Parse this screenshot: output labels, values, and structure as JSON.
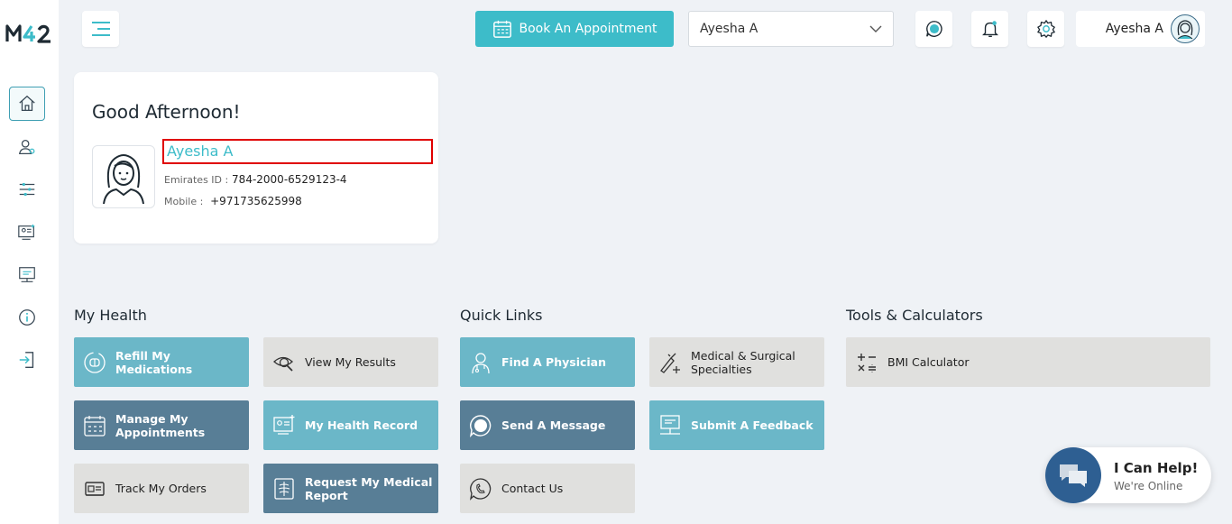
{
  "brand": {
    "logo_text": "M42",
    "accent": "#3dbcc9",
    "highlight_border": "#e00000"
  },
  "sidebar": {
    "items": [
      {
        "name": "home",
        "icon": "home-icon",
        "active": true
      },
      {
        "name": "profile",
        "icon": "user-doctor-icon"
      },
      {
        "name": "filters",
        "icon": "sliders-icon"
      },
      {
        "name": "health-record",
        "icon": "monitor-record-icon"
      },
      {
        "name": "feedback",
        "icon": "monitor-feedback-icon"
      },
      {
        "name": "info",
        "icon": "info-icon"
      },
      {
        "name": "logout",
        "icon": "logout-icon"
      }
    ]
  },
  "topbar": {
    "book_label": "Book An Appointment",
    "selected_profile": "Ayesha A",
    "user_name": "Ayesha A"
  },
  "greeting": {
    "title": "Good Afternoon!",
    "patient_name": "Ayesha A",
    "emirates_label": "Emirates ID :",
    "emirates_value": "784-2000-6529123-4",
    "mobile_label": "Mobile :",
    "mobile_value": "+971735625998"
  },
  "sections": {
    "my_health": "My Health",
    "quick_links": "Quick Links",
    "tools": "Tools & Calculators"
  },
  "tiles": {
    "refill": "Refill My Medications",
    "view_results": "View My Results",
    "manage_appointments_1": "Manage My",
    "manage_appointments_2": "Appointments",
    "health_record": "My Health Record",
    "track_orders": "Track My Orders",
    "medical_report_1": "Request My Medical",
    "medical_report_2": "Report",
    "find_physician": "Find A Physician",
    "specialties_1": "Medical & Surgical",
    "specialties_2": "Specialties",
    "send_message": "Send A Message",
    "submit_feedback": "Submit A Feedback",
    "contact_us": "Contact Us",
    "bmi": "BMI Calculator"
  },
  "chat": {
    "title": "I Can Help!",
    "status": "We're Online"
  }
}
